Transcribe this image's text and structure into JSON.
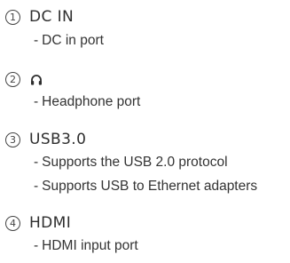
{
  "ports": [
    {
      "number": "1",
      "name": "DC IN",
      "icon": "",
      "bullets": [
        "DC in port"
      ]
    },
    {
      "number": "2",
      "name": "",
      "icon": "headphone-icon",
      "bullets": [
        "Headphone port"
      ]
    },
    {
      "number": "3",
      "name": "USB3.0",
      "icon": "",
      "bullets": [
        "Supports the USB 2.0 protocol",
        "Supports USB to Ethernet adapters"
      ]
    },
    {
      "number": "4",
      "name": "HDMI",
      "icon": "",
      "bullets": [
        "HDMI input port"
      ]
    }
  ],
  "bullet_marker": "-",
  "colors": {
    "text": "#333333",
    "background": "#ffffff"
  }
}
